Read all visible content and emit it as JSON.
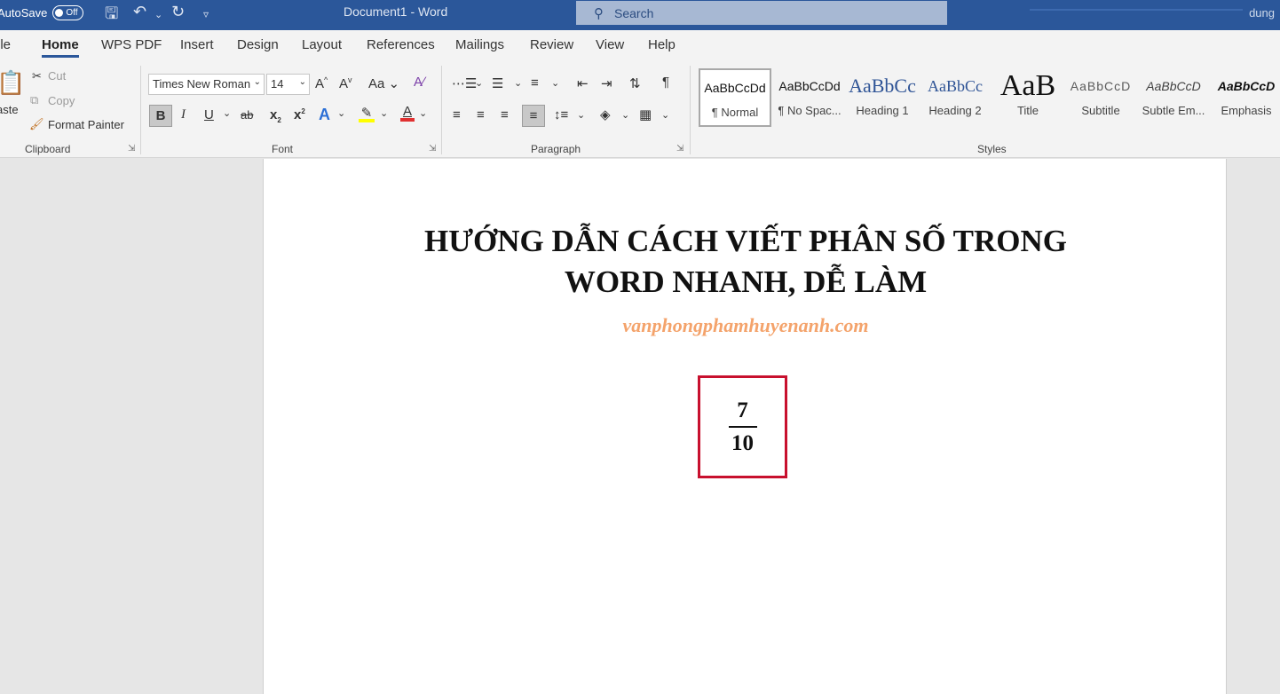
{
  "titlebar": {
    "autosave_label": "AutoSave",
    "autosave_state": "Off",
    "doc_title": "Document1  -  Word",
    "search_placeholder": "Search",
    "user": "dung",
    "bg_color": "#2b579a"
  },
  "menu": {
    "tabs": [
      "File",
      "Home",
      "WPS PDF",
      "Insert",
      "Design",
      "Layout",
      "References",
      "Mailings",
      "Review",
      "View",
      "Help"
    ],
    "active": "Home"
  },
  "clipboard": {
    "paste": "Paste",
    "cut": "Cut",
    "copy": "Copy",
    "format_painter": "Format Painter",
    "label": "Clipboard"
  },
  "font": {
    "name": "Times New Roman",
    "size": "14",
    "label": "Font",
    "grow": "A",
    "shrink": "A",
    "case": "Aa",
    "bold": "B",
    "italic": "I",
    "underline": "U",
    "strike": "ab",
    "subscript": "x",
    "superscript": "x",
    "highlight_color": "#ffff00",
    "font_color": "#e03030"
  },
  "paragraph": {
    "label": "Paragraph"
  },
  "styles": {
    "label": "Styles",
    "items": [
      {
        "sample": "AaBbCcDd",
        "name": "¶ Normal"
      },
      {
        "sample": "AaBbCcDd",
        "name": "¶ No Spac..."
      },
      {
        "sample": "AaBbCc",
        "name": "Heading 1"
      },
      {
        "sample": "AaBbCc",
        "name": "Heading 2"
      },
      {
        "sample": "AaB",
        "name": "Title"
      },
      {
        "sample": "AaBbCcD",
        "name": "Subtitle"
      },
      {
        "sample": "AaBbCcD",
        "name": "Subtle Em..."
      },
      {
        "sample": "AaBbCcD",
        "name": "Emphasis"
      }
    ]
  },
  "document": {
    "heading_line1": "HƯỚNG DẪN CÁCH VIẾT PHÂN SỐ TRONG",
    "heading_line2": "WORD NHANH, DỄ LÀM",
    "subtitle": "vanphongphamhuyenanh.com",
    "subtitle_color": "#f4a36b",
    "fraction": {
      "numerator": "7",
      "denominator": "10"
    },
    "highlight_box_color": "#c8102e"
  }
}
